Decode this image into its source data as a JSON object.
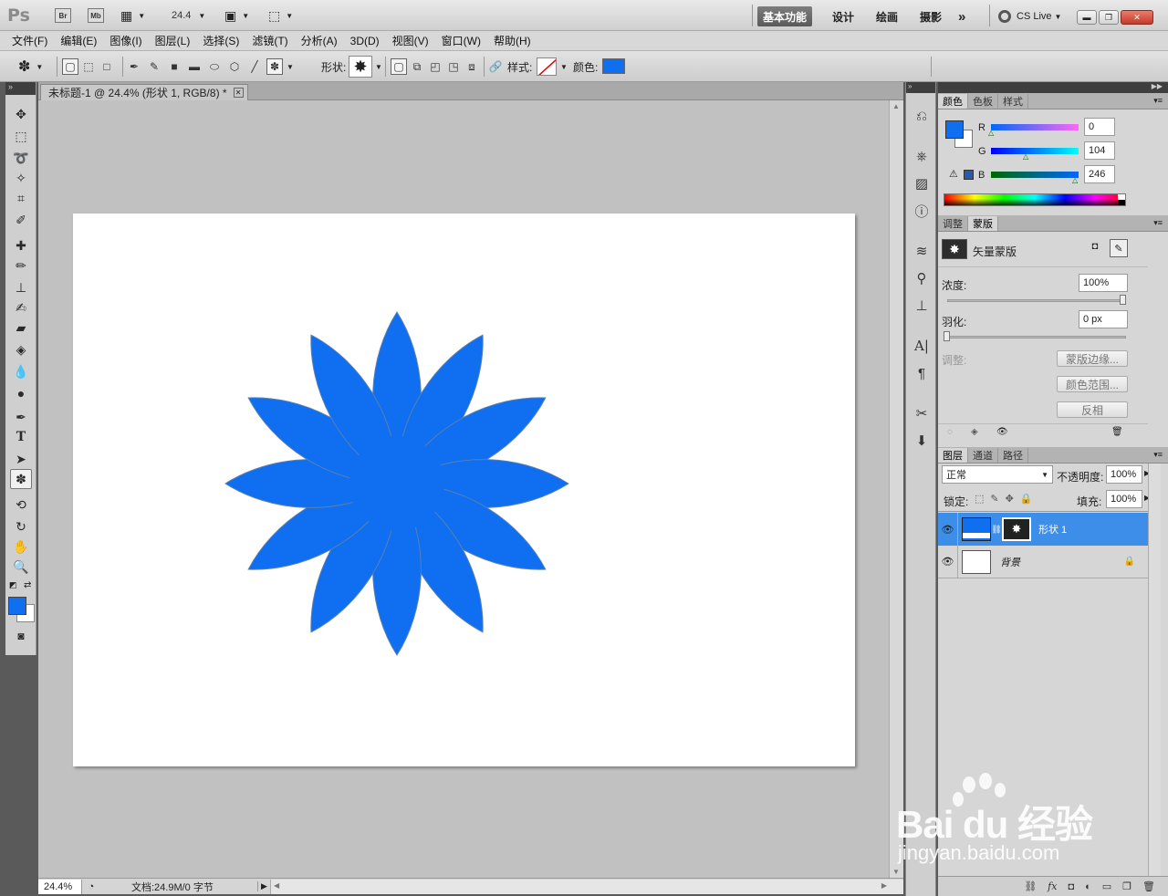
{
  "appbar": {
    "ps_logo": "Ps",
    "br": "Br",
    "mb": "Mb",
    "zoom": "24.4",
    "workspaces": [
      "基本功能",
      "设计",
      "绘画",
      "摄影"
    ],
    "more": "»",
    "cslive": "CS Live"
  },
  "menu": [
    "文件(F)",
    "编辑(E)",
    "图像(I)",
    "图层(L)",
    "选择(S)",
    "滤镜(T)",
    "分析(A)",
    "3D(D)",
    "视图(V)",
    "窗口(W)",
    "帮助(H)"
  ],
  "options": {
    "shape_label": "形状:",
    "style_label": "样式:",
    "color_label": "颜色:",
    "color": "#0f6ff0"
  },
  "document": {
    "tab_title": "未标题-1 @ 24.4% (形状 1, RGB/8) *",
    "shape_color": "#0f6ff0",
    "zoom_status": "24.4%",
    "doc_info": "文档:24.9M/0 字节"
  },
  "color_panel": {
    "tabs": [
      "颜色",
      "色板",
      "样式"
    ],
    "r_label": "R",
    "g_label": "G",
    "b_label": "B",
    "r": "0",
    "g": "104",
    "b": "246",
    "fg_color": "#0f6ff0"
  },
  "masks_panel": {
    "tabs": [
      "调整",
      "蒙版"
    ],
    "mask_type": "矢量蒙版",
    "density_label": "浓度:",
    "density": "100%",
    "feather_label": "羽化:",
    "feather": "0 px",
    "refine_label": "调整:",
    "btn_edge": "蒙版边缘...",
    "btn_range": "颜色范围...",
    "btn_invert": "反相"
  },
  "layers_panel": {
    "tabs": [
      "图层",
      "通道",
      "路径"
    ],
    "blend_mode": "正常",
    "opacity_label": "不透明度:",
    "opacity": "100%",
    "lock_label": "锁定:",
    "fill_label": "填充:",
    "fill": "100%",
    "layers": [
      {
        "name": "形状 1",
        "selected": true
      },
      {
        "name": "背景",
        "selected": false
      }
    ]
  },
  "watermark": {
    "brand": "Bai du 经验",
    "url": "jingyan.baidu.com"
  }
}
